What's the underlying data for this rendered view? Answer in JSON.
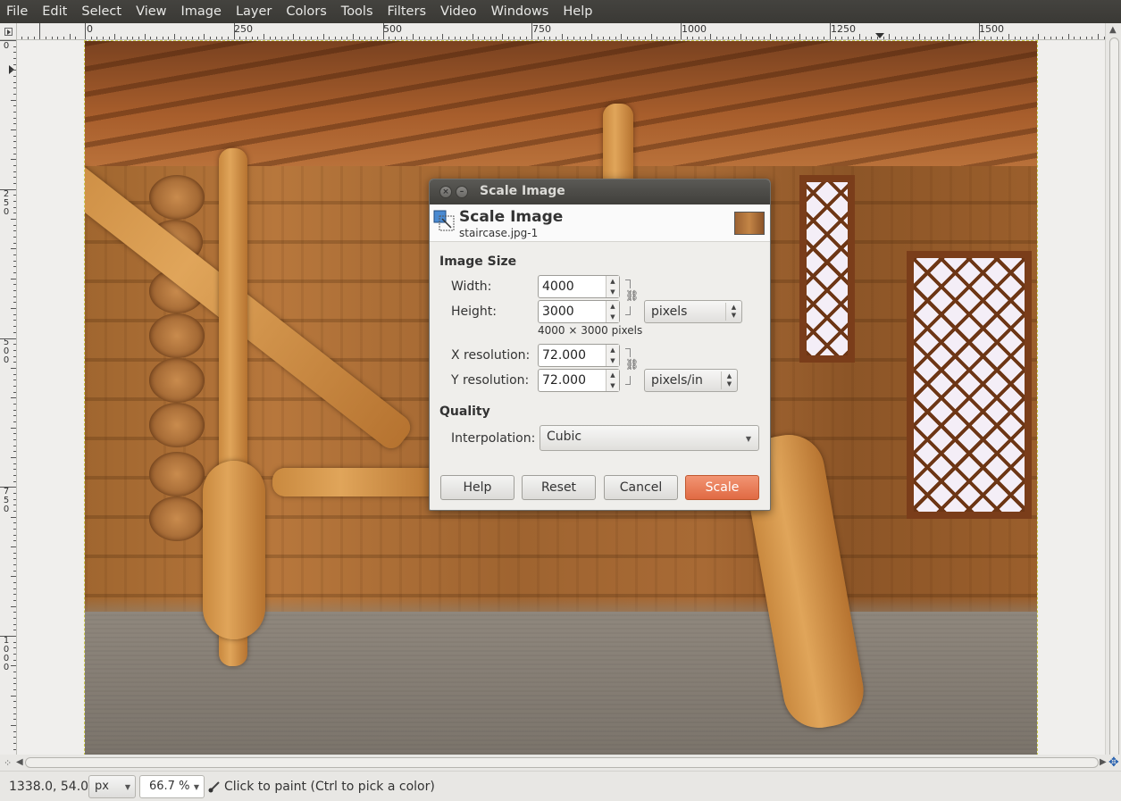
{
  "menubar": {
    "items": [
      "File",
      "Edit",
      "Select",
      "View",
      "Image",
      "Layer",
      "Colors",
      "Tools",
      "Filters",
      "Video",
      "Windows",
      "Help"
    ]
  },
  "rulers": {
    "h_labels": [
      "0",
      "250",
      "500",
      "750",
      "1000",
      "1250",
      "1500"
    ],
    "v_labels": [
      "0",
      "250",
      "500",
      "750",
      "1000"
    ]
  },
  "dialog": {
    "window_title": "Scale Image",
    "header_title": "Scale Image",
    "header_subtitle": "staircase.jpg-1",
    "image_size_title": "Image Size",
    "width_label": "Width:",
    "width_value": "4000",
    "height_label": "Height:",
    "height_value": "3000",
    "size_unit": "pixels",
    "size_info": "4000 × 3000 pixels",
    "xres_label": "X resolution:",
    "xres_value": "72.000",
    "yres_label": "Y resolution:",
    "yres_value": "72.000",
    "res_unit": "pixels/in",
    "quality_title": "Quality",
    "interp_label": "Interpolation:",
    "interp_value": "Cubic",
    "buttons": {
      "help": "Help",
      "reset": "Reset",
      "cancel": "Cancel",
      "scale": "Scale"
    }
  },
  "statusbar": {
    "coords": "1338.0, 54.0",
    "unit": "px",
    "zoom": "66.7 %",
    "message": "Click to paint (Ctrl to pick a color)"
  },
  "colors": {
    "menubar_bg": "#3d3c38",
    "primary_button": "#e8734b",
    "dialog_titlebar": "#4a4945"
  }
}
